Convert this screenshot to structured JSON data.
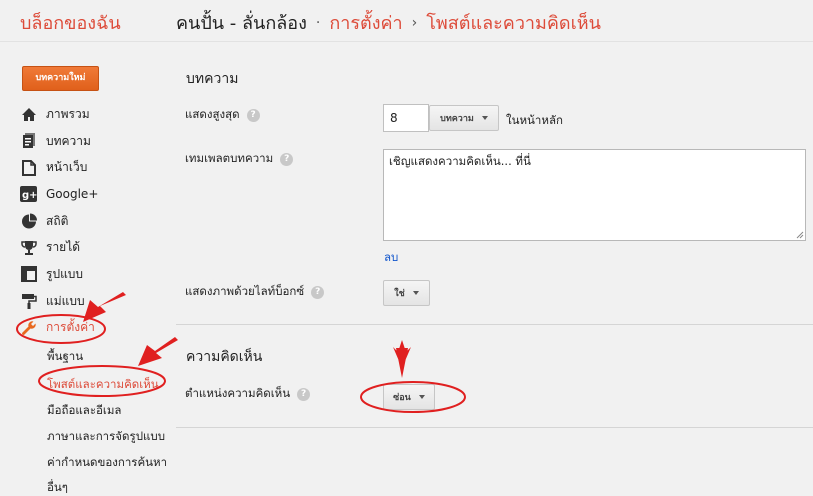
{
  "header": {
    "brand": "บล็อกของฉัน",
    "blog_name": "คนปั้น - ลั่นกล้อง",
    "sep1": "·",
    "crumb_settings": "การตั้งค่า",
    "sep2": "›",
    "crumb_current": "โพสต์และความคิดเห็น"
  },
  "sidebar": {
    "new_post": "บทความใหม่",
    "items": [
      {
        "label": "ภาพรวม",
        "icon": "home-icon"
      },
      {
        "label": "บทความ",
        "icon": "posts-icon"
      },
      {
        "label": "หน้าเว็บ",
        "icon": "pages-icon"
      },
      {
        "label": "Google+",
        "icon": "google-plus-icon"
      },
      {
        "label": "สถิติ",
        "icon": "stats-pie-icon"
      },
      {
        "label": "รายได้",
        "icon": "trophy-icon"
      },
      {
        "label": "รูปแบบ",
        "icon": "layout-icon"
      },
      {
        "label": "แม่แบบ",
        "icon": "paint-roller-icon"
      },
      {
        "label": "การตั้งค่า",
        "icon": "wrench-icon"
      }
    ],
    "sub_items": [
      "พื้นฐาน",
      "โพสต์และความคิดเห็น",
      "มือถือและอีเมล",
      "ภาษาและการจัดรูปแบบ",
      "ค่ากำหนดของการค้นหา",
      "อื่นๆ"
    ]
  },
  "posts_section": {
    "title": "บทความ",
    "show_max_label": "แสดงสูงสุด",
    "show_max_value": "8",
    "unit_dropdown": "บทความ",
    "on_home_page": "ในหน้าหลัก",
    "template_label": "เทมเพลตบทความ",
    "template_value": "เชิญแสดงความคิดเห็น... ที่นี่",
    "delete_link": "ลบ",
    "lightbox_label": "แสดงภาพด้วยไลท์บ็อกซ์",
    "lightbox_value": "ใช่"
  },
  "comments_section": {
    "title": "ความคิดเห็น",
    "location_label": "ตำแหน่งความคิดเห็น",
    "location_value": "ซ่อน"
  },
  "help_glyph": "?",
  "colors": {
    "accent": "#dd4b39",
    "button_orange": "#e8691f",
    "link": "#1155cc",
    "annotation_red": "#e02020"
  }
}
